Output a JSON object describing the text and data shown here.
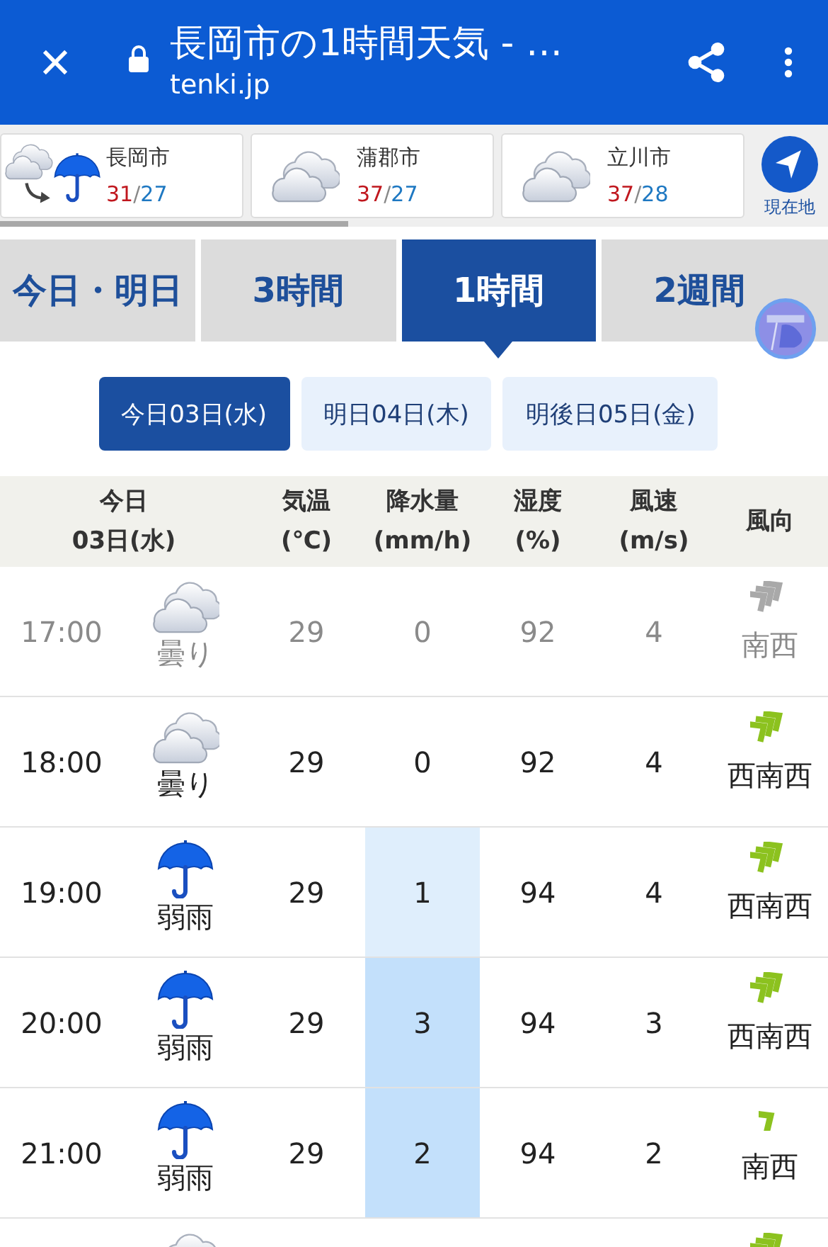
{
  "app_bar": {
    "title": "長岡市の1時間天気 - …",
    "url": "tenki.jp"
  },
  "cities": [
    {
      "name": "長岡市",
      "icon": {
        "kind": "change"
      },
      "high": "31",
      "separator": "/",
      "low": "27"
    },
    {
      "name": "蒲郡市",
      "icon": {
        "kind": "cloudy"
      },
      "high": "37",
      "separator": "/",
      "low": "27"
    },
    {
      "name": "立川市",
      "icon": {
        "kind": "cloudy"
      },
      "high": "37",
      "separator": "/",
      "low": "28"
    }
  ],
  "location_button": {
    "label": "現在地"
  },
  "tabs": [
    {
      "label": "今日・明日",
      "selected": false
    },
    {
      "label": "3時間",
      "selected": false
    },
    {
      "label": "1時間",
      "selected": true
    },
    {
      "label": "2週間",
      "selected": false
    }
  ],
  "days": [
    {
      "label": "今日03日(水)",
      "selected": true
    },
    {
      "label": "明日04日(木)",
      "selected": false
    },
    {
      "label": "明後日05日(金)",
      "selected": false
    }
  ],
  "table": {
    "columns": [
      {
        "label": "今日",
        "sub": "03日(水)"
      },
      {
        "label": "気温",
        "sub": "(℃)"
      },
      {
        "label": "降水量",
        "sub": "(mm/h)"
      },
      {
        "label": "湿度",
        "sub": "(%)"
      },
      {
        "label": "風速",
        "sub": "(m/s)"
      },
      {
        "label": "風向"
      }
    ],
    "rows": [
      {
        "time": "17:00",
        "weather": {
          "kind": "cloudy",
          "label": "曇り"
        },
        "temp": "29",
        "precip": {
          "value": "0"
        },
        "humidity": "92",
        "wind_speed": "4",
        "wind": {
          "kind": "strong",
          "label": "南西"
        },
        "past": true
      },
      {
        "time": "18:00",
        "weather": {
          "kind": "cloudy",
          "label": "曇り"
        },
        "temp": "29",
        "precip": {
          "value": "0"
        },
        "humidity": "92",
        "wind_speed": "4",
        "wind": {
          "kind": "strong",
          "label": "西南西"
        },
        "past": false
      },
      {
        "time": "19:00",
        "weather": {
          "kind": "rain",
          "label": "弱雨"
        },
        "temp": "29",
        "precip": {
          "value": "1",
          "color": "#dfeefc"
        },
        "humidity": "94",
        "wind_speed": "4",
        "wind": {
          "kind": "strong",
          "label": "西南西"
        },
        "past": false
      },
      {
        "time": "20:00",
        "weather": {
          "kind": "rain",
          "label": "弱雨"
        },
        "temp": "29",
        "precip": {
          "value": "3",
          "color": "#c3e0fb"
        },
        "humidity": "94",
        "wind_speed": "3",
        "wind": {
          "kind": "strong",
          "label": "西南西"
        },
        "past": false
      },
      {
        "time": "21:00",
        "weather": {
          "kind": "rain",
          "label": "弱雨"
        },
        "temp": "29",
        "precip": {
          "value": "2",
          "color": "#c3e0fb"
        },
        "humidity": "94",
        "wind_speed": "2",
        "wind": {
          "kind": "light",
          "label": "南西"
        },
        "past": false
      },
      {
        "weather": {
          "kind": "cloudy"
        },
        "wind": {
          "kind": "strong"
        },
        "past": false
      }
    ]
  }
}
